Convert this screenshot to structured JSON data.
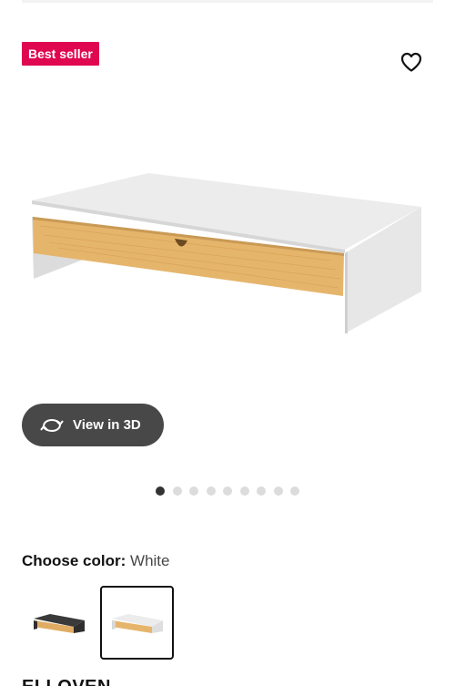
{
  "badge": {
    "label": "Best seller",
    "color": "#e00751"
  },
  "favorite": {
    "icon": "heart-outline-icon"
  },
  "product_image": {
    "subject": "monitor stand with drawer"
  },
  "view3d": {
    "label": "View in 3D",
    "icon": "rotate-3d-icon"
  },
  "carousel": {
    "count": 9,
    "active_index": 0
  },
  "color": {
    "label": "Choose color:",
    "value": "White"
  },
  "swatches": [
    {
      "name": "Black-brown",
      "selected": false
    },
    {
      "name": "White",
      "selected": true
    }
  ],
  "product": {
    "title": "ELLOVEN"
  }
}
